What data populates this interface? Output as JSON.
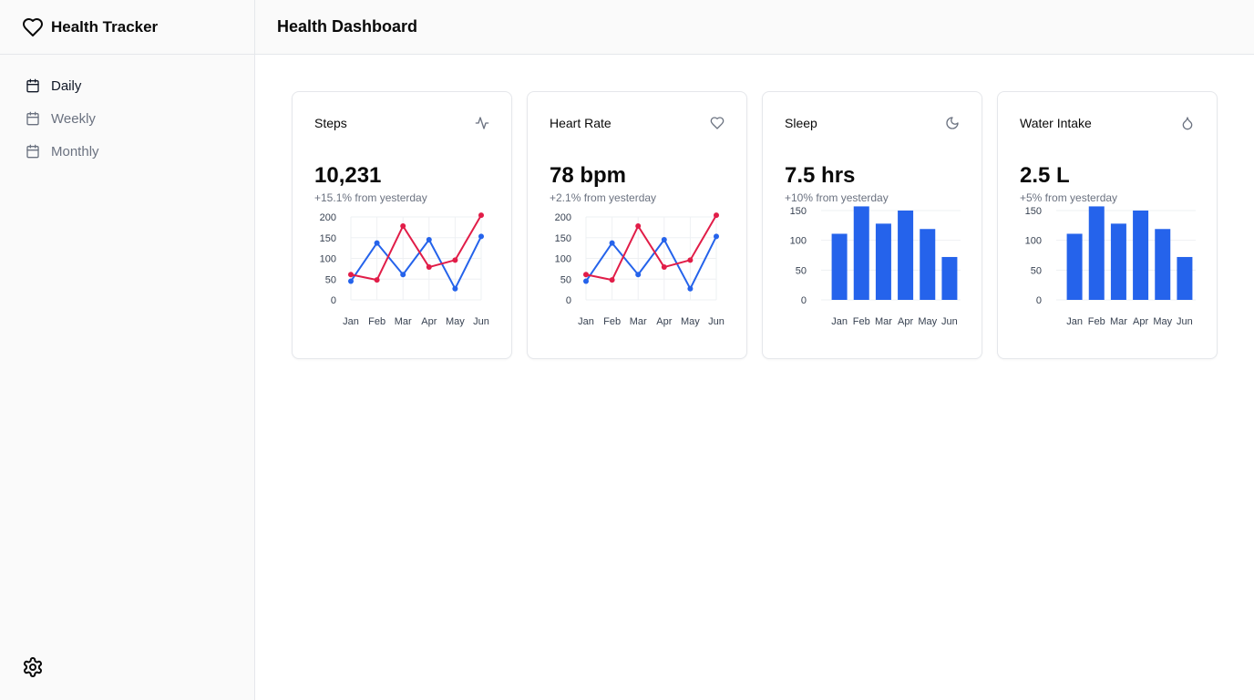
{
  "app": {
    "title": "Health Tracker"
  },
  "header": {
    "title": "Health Dashboard"
  },
  "sidebar": {
    "items": [
      {
        "label": "Daily",
        "active": true,
        "icon": "calendar-icon"
      },
      {
        "label": "Weekly",
        "active": false,
        "icon": "calendar-icon"
      },
      {
        "label": "Monthly",
        "active": false,
        "icon": "calendar-icon"
      }
    ],
    "settings_icon": "gear-icon"
  },
  "colors": {
    "blue": "#2563eb",
    "red": "#e11d48",
    "muted": "#6b7280",
    "grid": "#eef0f3"
  },
  "cards": [
    {
      "title": "Steps",
      "icon": "activity-icon",
      "value": "10,231",
      "change": "+15.1% from yesterday"
    },
    {
      "title": "Heart Rate",
      "icon": "heart-icon",
      "value": "78 bpm",
      "change": "+2.1% from yesterday"
    },
    {
      "title": "Sleep",
      "icon": "moon-icon",
      "value": "7.5 hrs",
      "change": "+10% from yesterday"
    },
    {
      "title": "Water Intake",
      "icon": "droplet-icon",
      "value": "2.5 L",
      "change": "+5% from yesterday"
    }
  ],
  "chart_data": [
    {
      "type": "line",
      "categories": [
        "Jan",
        "Feb",
        "Mar",
        "Apr",
        "May",
        "Jun"
      ],
      "yticks": [
        0,
        50,
        100,
        150,
        200
      ],
      "ylim": [
        0,
        200
      ],
      "grid": true,
      "series": [
        {
          "values": [
            45,
            137,
            61,
            145,
            27,
            153
          ],
          "color": "#2563eb"
        },
        {
          "values": [
            61,
            48,
            178,
            79,
            96,
            204
          ],
          "color": "#e11d48"
        }
      ]
    },
    {
      "type": "line",
      "categories": [
        "Jan",
        "Feb",
        "Mar",
        "Apr",
        "May",
        "Jun"
      ],
      "yticks": [
        0,
        50,
        100,
        150,
        200
      ],
      "ylim": [
        0,
        200
      ],
      "grid": true,
      "series": [
        {
          "values": [
            45,
            137,
            61,
            145,
            27,
            153
          ],
          "color": "#2563eb"
        },
        {
          "values": [
            61,
            48,
            178,
            79,
            96,
            204
          ],
          "color": "#e11d48"
        }
      ]
    },
    {
      "type": "bar",
      "categories": [
        "Jan",
        "Feb",
        "Mar",
        "Apr",
        "May",
        "Jun"
      ],
      "yticks": [
        0,
        50,
        100,
        150
      ],
      "ylim": [
        0,
        150
      ],
      "grid": true,
      "values": [
        111,
        157,
        128,
        150,
        119,
        72
      ],
      "color": "#2563eb"
    },
    {
      "type": "bar",
      "categories": [
        "Jan",
        "Feb",
        "Mar",
        "Apr",
        "May",
        "Jun"
      ],
      "yticks": [
        0,
        50,
        100,
        150
      ],
      "ylim": [
        0,
        150
      ],
      "grid": true,
      "values": [
        111,
        157,
        128,
        150,
        119,
        72
      ],
      "color": "#2563eb"
    }
  ]
}
